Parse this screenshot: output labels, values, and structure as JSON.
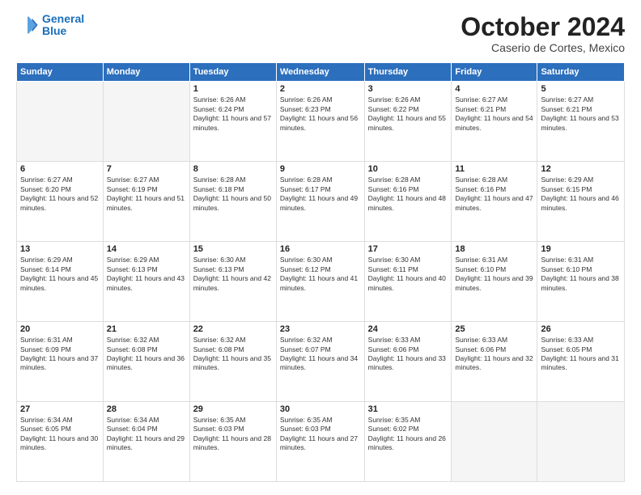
{
  "logo": {
    "line1": "General",
    "line2": "Blue"
  },
  "title": "October 2024",
  "subtitle": "Caserio de Cortes, Mexico",
  "days_of_week": [
    "Sunday",
    "Monday",
    "Tuesday",
    "Wednesday",
    "Thursday",
    "Friday",
    "Saturday"
  ],
  "weeks": [
    [
      {
        "day": "",
        "info": ""
      },
      {
        "day": "",
        "info": ""
      },
      {
        "day": "1",
        "info": "Sunrise: 6:26 AM\nSunset: 6:24 PM\nDaylight: 11 hours and 57 minutes."
      },
      {
        "day": "2",
        "info": "Sunrise: 6:26 AM\nSunset: 6:23 PM\nDaylight: 11 hours and 56 minutes."
      },
      {
        "day": "3",
        "info": "Sunrise: 6:26 AM\nSunset: 6:22 PM\nDaylight: 11 hours and 55 minutes."
      },
      {
        "day": "4",
        "info": "Sunrise: 6:27 AM\nSunset: 6:21 PM\nDaylight: 11 hours and 54 minutes."
      },
      {
        "day": "5",
        "info": "Sunrise: 6:27 AM\nSunset: 6:21 PM\nDaylight: 11 hours and 53 minutes."
      }
    ],
    [
      {
        "day": "6",
        "info": "Sunrise: 6:27 AM\nSunset: 6:20 PM\nDaylight: 11 hours and 52 minutes."
      },
      {
        "day": "7",
        "info": "Sunrise: 6:27 AM\nSunset: 6:19 PM\nDaylight: 11 hours and 51 minutes."
      },
      {
        "day": "8",
        "info": "Sunrise: 6:28 AM\nSunset: 6:18 PM\nDaylight: 11 hours and 50 minutes."
      },
      {
        "day": "9",
        "info": "Sunrise: 6:28 AM\nSunset: 6:17 PM\nDaylight: 11 hours and 49 minutes."
      },
      {
        "day": "10",
        "info": "Sunrise: 6:28 AM\nSunset: 6:16 PM\nDaylight: 11 hours and 48 minutes."
      },
      {
        "day": "11",
        "info": "Sunrise: 6:28 AM\nSunset: 6:16 PM\nDaylight: 11 hours and 47 minutes."
      },
      {
        "day": "12",
        "info": "Sunrise: 6:29 AM\nSunset: 6:15 PM\nDaylight: 11 hours and 46 minutes."
      }
    ],
    [
      {
        "day": "13",
        "info": "Sunrise: 6:29 AM\nSunset: 6:14 PM\nDaylight: 11 hours and 45 minutes."
      },
      {
        "day": "14",
        "info": "Sunrise: 6:29 AM\nSunset: 6:13 PM\nDaylight: 11 hours and 43 minutes."
      },
      {
        "day": "15",
        "info": "Sunrise: 6:30 AM\nSunset: 6:13 PM\nDaylight: 11 hours and 42 minutes."
      },
      {
        "day": "16",
        "info": "Sunrise: 6:30 AM\nSunset: 6:12 PM\nDaylight: 11 hours and 41 minutes."
      },
      {
        "day": "17",
        "info": "Sunrise: 6:30 AM\nSunset: 6:11 PM\nDaylight: 11 hours and 40 minutes."
      },
      {
        "day": "18",
        "info": "Sunrise: 6:31 AM\nSunset: 6:10 PM\nDaylight: 11 hours and 39 minutes."
      },
      {
        "day": "19",
        "info": "Sunrise: 6:31 AM\nSunset: 6:10 PM\nDaylight: 11 hours and 38 minutes."
      }
    ],
    [
      {
        "day": "20",
        "info": "Sunrise: 6:31 AM\nSunset: 6:09 PM\nDaylight: 11 hours and 37 minutes."
      },
      {
        "day": "21",
        "info": "Sunrise: 6:32 AM\nSunset: 6:08 PM\nDaylight: 11 hours and 36 minutes."
      },
      {
        "day": "22",
        "info": "Sunrise: 6:32 AM\nSunset: 6:08 PM\nDaylight: 11 hours and 35 minutes."
      },
      {
        "day": "23",
        "info": "Sunrise: 6:32 AM\nSunset: 6:07 PM\nDaylight: 11 hours and 34 minutes."
      },
      {
        "day": "24",
        "info": "Sunrise: 6:33 AM\nSunset: 6:06 PM\nDaylight: 11 hours and 33 minutes."
      },
      {
        "day": "25",
        "info": "Sunrise: 6:33 AM\nSunset: 6:06 PM\nDaylight: 11 hours and 32 minutes."
      },
      {
        "day": "26",
        "info": "Sunrise: 6:33 AM\nSunset: 6:05 PM\nDaylight: 11 hours and 31 minutes."
      }
    ],
    [
      {
        "day": "27",
        "info": "Sunrise: 6:34 AM\nSunset: 6:05 PM\nDaylight: 11 hours and 30 minutes."
      },
      {
        "day": "28",
        "info": "Sunrise: 6:34 AM\nSunset: 6:04 PM\nDaylight: 11 hours and 29 minutes."
      },
      {
        "day": "29",
        "info": "Sunrise: 6:35 AM\nSunset: 6:03 PM\nDaylight: 11 hours and 28 minutes."
      },
      {
        "day": "30",
        "info": "Sunrise: 6:35 AM\nSunset: 6:03 PM\nDaylight: 11 hours and 27 minutes."
      },
      {
        "day": "31",
        "info": "Sunrise: 6:35 AM\nSunset: 6:02 PM\nDaylight: 11 hours and 26 minutes."
      },
      {
        "day": "",
        "info": ""
      },
      {
        "day": "",
        "info": ""
      }
    ]
  ]
}
